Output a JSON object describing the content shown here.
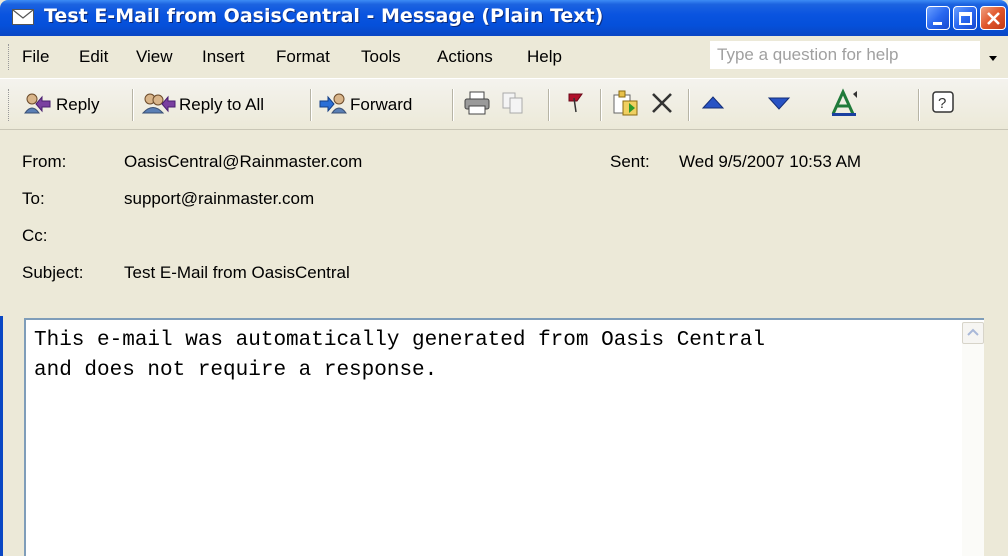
{
  "window": {
    "title": "Test E-Mail from OasisCentral - Message (Plain Text)"
  },
  "menu": {
    "items": [
      "File",
      "Edit",
      "View",
      "Insert",
      "Format",
      "Tools",
      "Actions",
      "Help"
    ],
    "help_placeholder": "Type a question for help"
  },
  "toolbar": {
    "reply_label": "Reply",
    "reply_all_label": "Reply to All",
    "forward_label": "Forward",
    "icons": [
      "reply-icon",
      "reply-all-icon",
      "forward-icon",
      "print-icon",
      "copy-icon",
      "flag-icon",
      "move-to-folder-icon",
      "delete-icon",
      "previous-item-icon",
      "next-item-icon",
      "address-book-icon",
      "help-icon"
    ]
  },
  "header": {
    "from_label": "From:",
    "from_value": "OasisCentral@Rainmaster.com",
    "sent_label": "Sent:",
    "sent_value": "Wed 9/5/2007 10:53 AM",
    "to_label": "To:",
    "to_value": "support@rainmaster.com",
    "cc_label": "Cc:",
    "cc_value": "",
    "subject_label": "Subject:",
    "subject_value": "Test E-Mail from OasisCentral"
  },
  "body": {
    "line1": "This e-mail was automatically generated from Oasis Central",
    "line2": "and does not require a response."
  },
  "colors": {
    "titlebar": "#0a54e0",
    "window_bg": "#ece9d8",
    "close_button": "#e0552a"
  }
}
